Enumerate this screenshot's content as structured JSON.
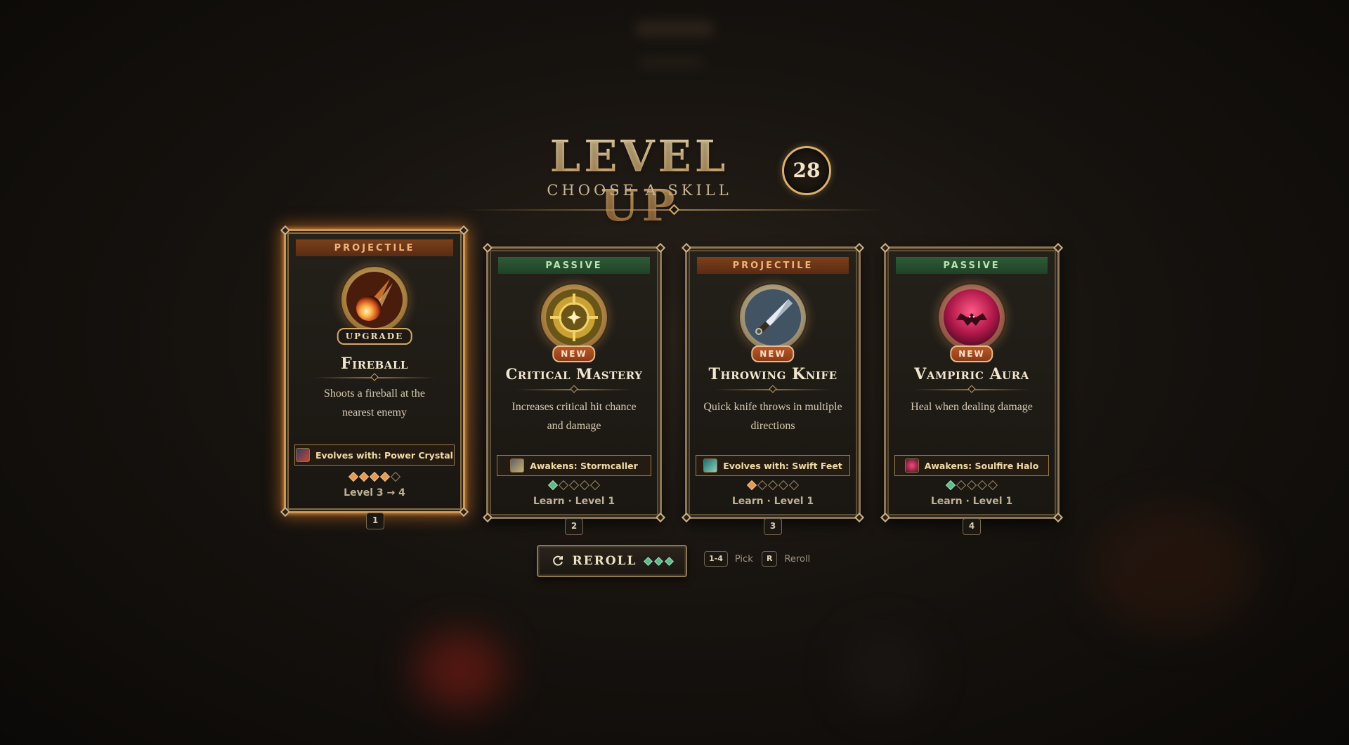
{
  "header": {
    "title": "LEVEL UP",
    "subtitle": "CHOOSE A SKILL",
    "level": "28"
  },
  "cards": [
    {
      "category": "PROJECTILE",
      "tag": "UPGRADE",
      "name": "Fireball",
      "description": "Shoots a fireball at the nearest enemy",
      "evolve": "Evolves with: Power Crystal",
      "pips_filled": 4,
      "pips_total": 5,
      "level_text": "Level 3 → 4",
      "hotkey": "1",
      "selected": true,
      "icon": "fireball-icon"
    },
    {
      "category": "PASSIVE",
      "tag": "NEW",
      "name": "Critical Mastery",
      "description": "Increases critical hit chance and damage",
      "evolve": "Awakens: Stormcaller",
      "pips_filled": 1,
      "pips_total": 5,
      "level_text": "Learn · Level 1",
      "hotkey": "2",
      "selected": false,
      "icon": "crosshair-icon"
    },
    {
      "category": "PROJECTILE",
      "tag": "NEW",
      "name": "Throwing Knife",
      "description": "Quick knife throws in multiple directions",
      "evolve": "Evolves with: Swift Feet",
      "pips_filled": 1,
      "pips_total": 5,
      "level_text": "Learn · Level 1",
      "hotkey": "3",
      "selected": false,
      "icon": "knife-icon"
    },
    {
      "category": "PASSIVE",
      "tag": "NEW",
      "name": "Vampiric Aura",
      "description": "Heal when dealing damage",
      "evolve": "Awakens: Soulfire Halo",
      "pips_filled": 1,
      "pips_total": 5,
      "level_text": "Learn · Level 1",
      "hotkey": "4",
      "selected": false,
      "icon": "bat-icon"
    }
  ],
  "footer": {
    "reroll_label": "REROLL",
    "reroll_charges": 3,
    "hint_pick_key": "1-4",
    "hint_pick_label": "Pick",
    "hint_reroll_key": "R",
    "hint_reroll_label": "Reroll"
  },
  "colors": {
    "projectile": "#7a3f1c",
    "passive": "#2e5a36",
    "gold": "#d9b06c",
    "selected_glow": "#d67828"
  }
}
